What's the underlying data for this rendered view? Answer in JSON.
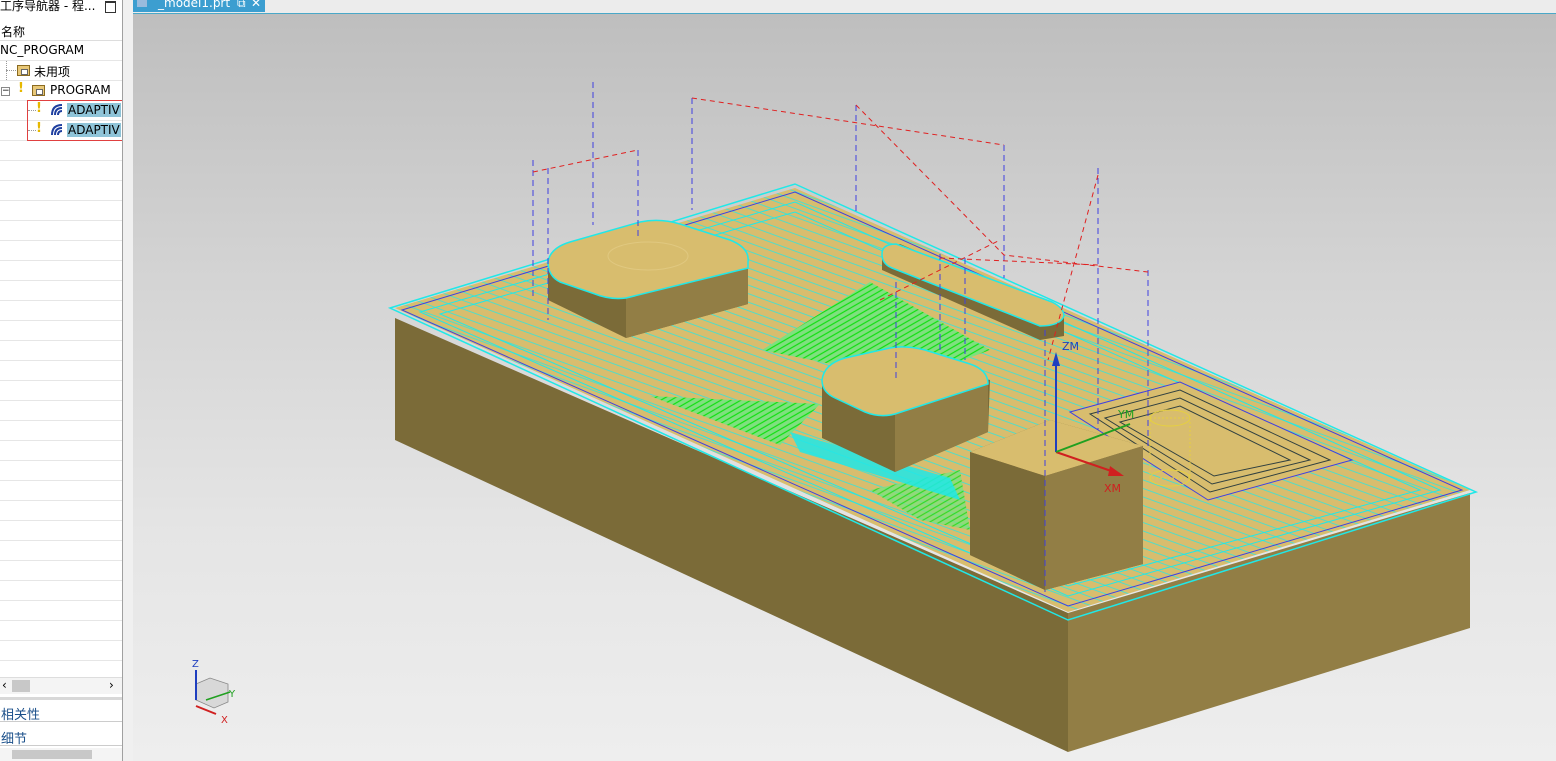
{
  "navigator": {
    "title": "工序导航器 - 程...",
    "column_name": "名称",
    "tree": {
      "root": "NC_PROGRAM",
      "unused": "未用项",
      "program": "PROGRAM",
      "operations": [
        "ADAPTIV",
        "ADAPTIV"
      ]
    },
    "panels": {
      "dependencies": "相关性",
      "details": "细节"
    }
  },
  "tab": {
    "filename": "_model1.prt",
    "close": "✕"
  },
  "viewport": {
    "wcs_labels": {
      "zm": "ZM",
      "ym": "YM",
      "xm": "XM"
    },
    "triad_labels": {
      "z": "Z",
      "y": "Y",
      "x": "X"
    }
  },
  "colors": {
    "part_top": "#d8bd6e",
    "part_front": "#7b6b38",
    "part_side": "#927e45",
    "toolpath_cyan": "#20e8e8",
    "toolpath_green": "#10e010",
    "engage_blue": "#4040e0",
    "rapid_red": "#e02020",
    "selection_red": "#e04040",
    "tab_blue": "#3c9ed0"
  }
}
